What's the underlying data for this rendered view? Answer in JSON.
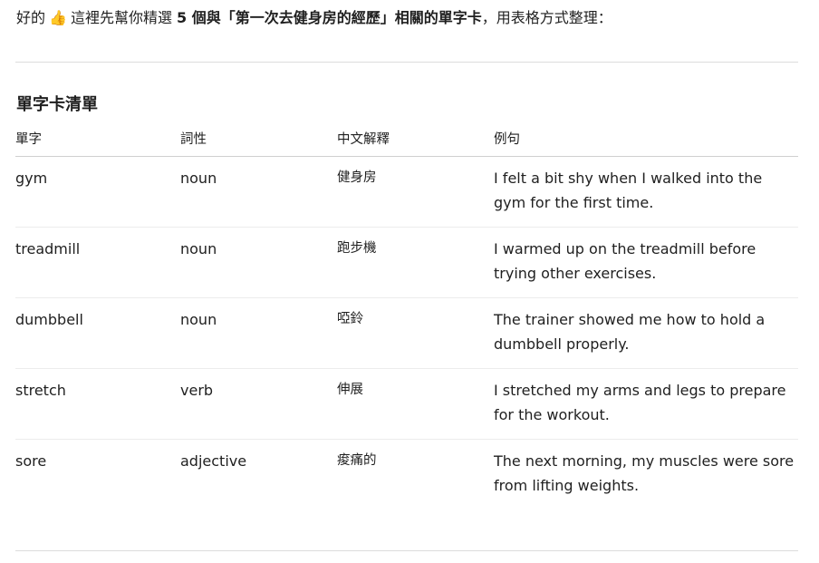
{
  "intro": {
    "prefix": "好的",
    "emoji": "👍",
    "mid": "這裡先幫你精選",
    "bold": "5 個與「第一次去健身房的經歷」相關的單字卡",
    "suffix": "，用表格方式整理："
  },
  "section_title": "單字卡清單",
  "table": {
    "headers": [
      "單字",
      "詞性",
      "中文解釋",
      "例句"
    ],
    "rows": [
      {
        "word": "gym",
        "pos": "noun",
        "zh": "健身房",
        "example": "I felt a bit shy when I walked into the gym for the first time."
      },
      {
        "word": "treadmill",
        "pos": "noun",
        "zh": "跑步機",
        "example": "I warmed up on the treadmill before trying other exercises."
      },
      {
        "word": "dumbbell",
        "pos": "noun",
        "zh": "啞鈴",
        "example": "The trainer showed me how to hold a dumbbell properly."
      },
      {
        "word": "stretch",
        "pos": "verb",
        "zh": "伸展",
        "example": "I stretched my arms and legs to prepare for the workout."
      },
      {
        "word": "sore",
        "pos": "adjective",
        "zh": "痠痛的",
        "example": "The next morning, my muscles were sore from lifting weights."
      }
    ]
  }
}
